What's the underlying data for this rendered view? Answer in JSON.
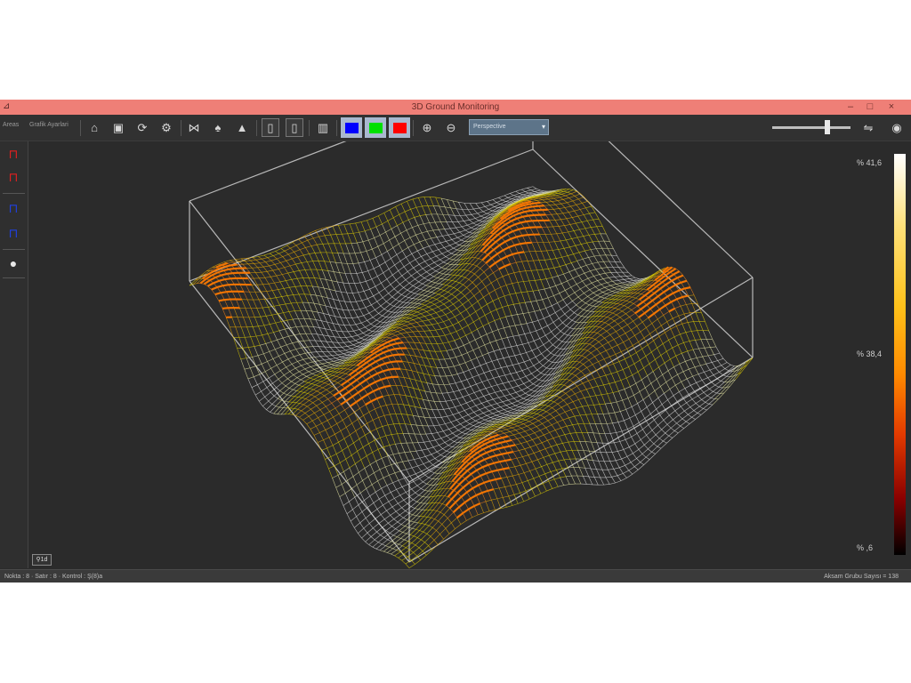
{
  "window": {
    "title": "3D Ground Monitoring",
    "app_icon": "app-icon",
    "controls": {
      "minimize": "–",
      "maximize": "□",
      "close": "×"
    }
  },
  "toolbar": {
    "label_left_1": "Areas",
    "label_left_2": "Grafik Ayarlari",
    "buttons": [
      {
        "id": "home",
        "icon": "home-icon",
        "glyph": "⌂"
      },
      {
        "id": "cube-front",
        "icon": "cube-icon",
        "glyph": "▣"
      },
      {
        "id": "cube-rotate",
        "icon": "cube-rotate-icon",
        "glyph": "⟳"
      },
      {
        "id": "settings",
        "icon": "gear-icon",
        "glyph": "⚙"
      },
      {
        "id": "surface-wire",
        "icon": "wireframe-icon",
        "glyph": "⋈"
      },
      {
        "id": "surface-peak",
        "icon": "peak-icon",
        "glyph": "♠"
      },
      {
        "id": "surface-mountain",
        "icon": "mountain-icon",
        "glyph": "▲"
      },
      {
        "id": "page-1",
        "icon": "page-icon",
        "glyph": "▯"
      },
      {
        "id": "page-2",
        "icon": "page-icon",
        "glyph": "▯"
      },
      {
        "id": "grid",
        "icon": "grid-icon",
        "glyph": "▥"
      },
      {
        "id": "zoom-in",
        "icon": "zoom-in-icon",
        "glyph": "⊕"
      },
      {
        "id": "zoom-out",
        "icon": "zoom-out-icon",
        "glyph": "⊖"
      }
    ],
    "color_swatches": [
      {
        "name": "blue",
        "color": "#0000ff"
      },
      {
        "name": "green",
        "color": "#00e000"
      },
      {
        "name": "red",
        "color": "#ff0000"
      }
    ],
    "projection_select": {
      "value": "Perspective"
    },
    "right_icons": [
      {
        "id": "signal",
        "icon": "signal-icon",
        "glyph": "⇋"
      },
      {
        "id": "globe",
        "icon": "globe-icon",
        "glyph": "◉"
      }
    ],
    "slider_level": 0.7
  },
  "left_panel": {
    "buttons": [
      {
        "icon": "axis-red-icon",
        "glyph": "⊓",
        "accent": "#e02020"
      },
      {
        "icon": "axis-red-icon",
        "glyph": "⊓",
        "accent": "#e02020"
      },
      {
        "icon": "axis-blue-icon",
        "glyph": "⊓",
        "accent": "#2040e0"
      },
      {
        "icon": "axis-blue-icon",
        "glyph": "⊓",
        "accent": "#2040e0"
      },
      {
        "icon": "sphere-icon",
        "glyph": "●",
        "accent": "#e8e8e8"
      }
    ]
  },
  "colorbar": {
    "labels": [
      "% 41,6",
      "% 38,4",
      "% ,6"
    ]
  },
  "view_badge": "⚲1d",
  "status": {
    "left": "Nokta : 8 · Satır : 8 · Kontrol : Ş(8)a",
    "right": "Aksam Grubu Sayısı = 138"
  }
}
